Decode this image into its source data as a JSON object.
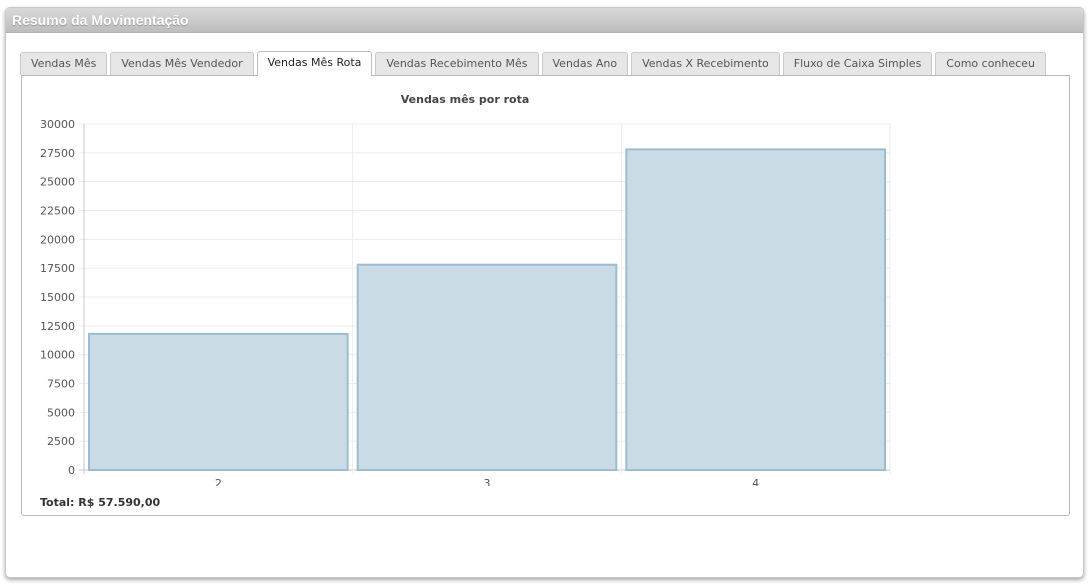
{
  "panel": {
    "title": "Resumo da Movimentação"
  },
  "tabs": [
    {
      "label": "Vendas Mês",
      "active": false
    },
    {
      "label": "Vendas Mês Vendedor",
      "active": false
    },
    {
      "label": "Vendas Mês Rota",
      "active": true
    },
    {
      "label": "Vendas Recebimento Mês",
      "active": false
    },
    {
      "label": "Vendas Ano",
      "active": false
    },
    {
      "label": "Vendas X Recebimento",
      "active": false
    },
    {
      "label": "Fluxo de Caixa Simples",
      "active": false
    },
    {
      "label": "Como conheceu",
      "active": false
    }
  ],
  "chart_data": {
    "type": "bar",
    "title": "Vendas mês por rota",
    "categories": [
      "2",
      "3",
      "4"
    ],
    "values": [
      11800,
      17800,
      27800
    ],
    "xlabel": "",
    "ylabel": "",
    "ylim": [
      0,
      30000
    ],
    "ytick_step": 2500,
    "grid": true,
    "bar_fill": "#c9dbe5",
    "bar_stroke": "#9dbccf"
  },
  "total_text": "Total: R$ 57.590,00"
}
